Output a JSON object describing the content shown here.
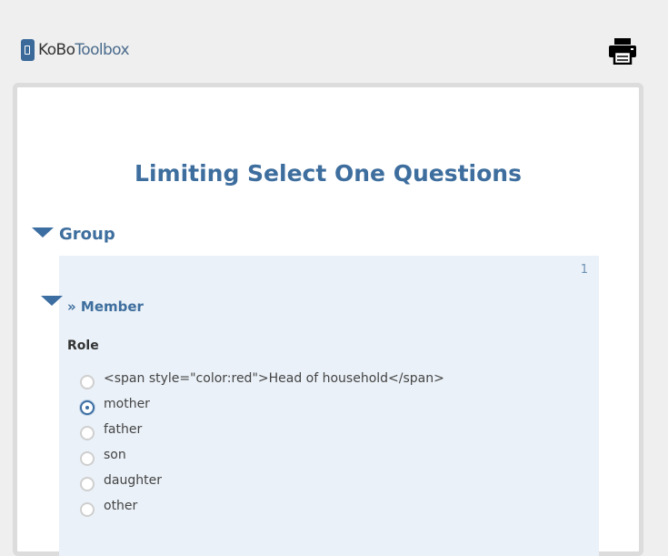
{
  "header": {
    "logo_primary": "KoBo",
    "logo_secondary": "Toolbox",
    "print_icon": "printer-icon"
  },
  "form": {
    "title": "Limiting Select One Questions",
    "group": {
      "title": "Group",
      "repeat": {
        "number": "1",
        "title": "» Member",
        "question": {
          "label": "Role",
          "options": [
            "<span style=\"color:red\">Head of household</span>",
            "mother",
            "father",
            "son",
            "daughter",
            "other"
          ],
          "selected": "mother"
        }
      }
    }
  },
  "colors": {
    "accent": "#3e6e9e",
    "repeat_background": "#eaf1f8"
  }
}
